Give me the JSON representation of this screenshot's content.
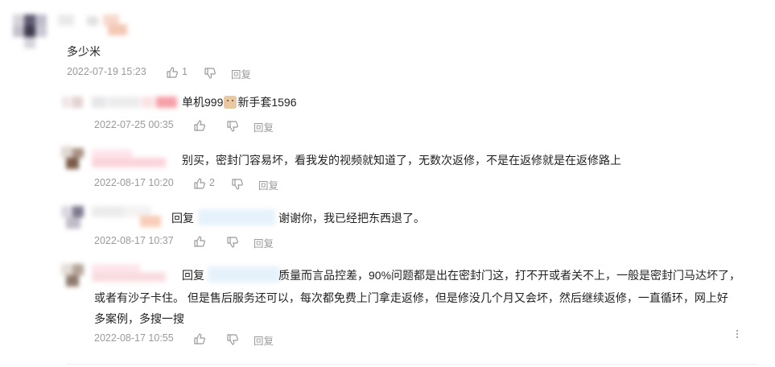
{
  "comments": [
    {
      "text": "多少米",
      "time": "2022-07-19 15:23",
      "likes": "1",
      "reply_label": "回复"
    },
    {
      "text_before_emoji": "单机999",
      "emoji_icon": "bear-face-emoji",
      "text_after_emoji": "新手套1596",
      "time": "2022-07-25 00:35",
      "reply_label": "回复"
    },
    {
      "text": "别买，密封门容易坏，看我发的视频就知道了，无数次返修，不是在返修就是在返修路上",
      "time": "2022-08-17 10:20",
      "likes": "2",
      "reply_label": "回复"
    },
    {
      "reply_prefix": "回复",
      "text": "谢谢你，我已经把东西退了。",
      "time": "2022-08-17 10:37",
      "reply_label": "回复"
    },
    {
      "reply_prefix": "回复",
      "line1": "质量而言品控差，90%问题都是出在密封门这，打不开或者关不上，一般是密封门马达坏了，",
      "line2": "或者有沙子卡住。 但是售后服务还可以，每次都免费上门拿走返修，但是修没几个月又会坏，然后继续返修，一直循环，网上好",
      "line3": "多案例，多搜一搜",
      "time": "2022-08-17 10:55",
      "reply_label": "回复"
    }
  ],
  "icons": {
    "like": "thumbs-up-icon",
    "dislike": "thumbs-down-icon",
    "more": "more-vertical-icon"
  }
}
